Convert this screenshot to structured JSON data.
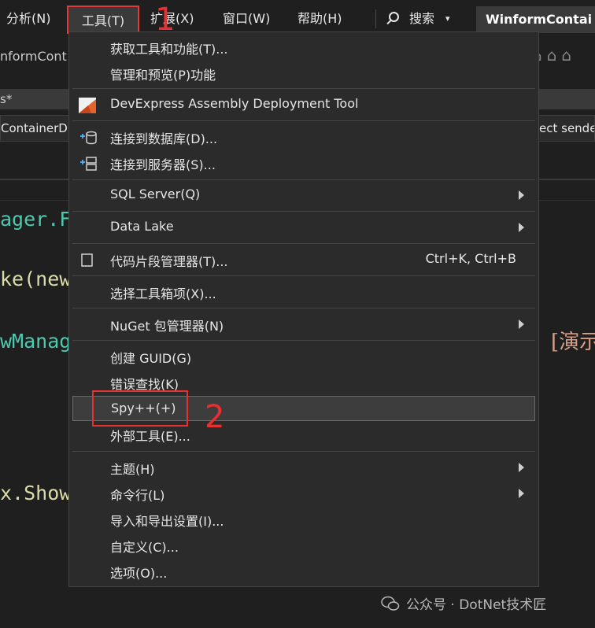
{
  "menubar": {
    "analyze": "分析(N)",
    "tools": "工具(T)",
    "extensions": "扩展(X)",
    "window": "窗口(W)",
    "help": "帮助(H)",
    "search": "搜索",
    "solution_title": "WinformContai"
  },
  "annotations": {
    "step1": "1",
    "step2": "2"
  },
  "background": {
    "title": "nformCont",
    "tab": "s*",
    "nav_left": "ContainerD",
    "nav_right": "ect sende",
    "code_1": "ager.Fi",
    "code_2": "ke(new",
    "code_3": "wManag",
    "code_4": "x.Show",
    "comment": "[演示"
  },
  "tools_menu": {
    "items": [
      {
        "label": "获取工具和功能(T)..."
      },
      {
        "label": "管理和预览(P)功能"
      },
      {
        "label": "DevExpress Assembly Deployment Tool",
        "icon": "devexpress-icon"
      },
      {
        "label": "连接到数据库(D)...",
        "icon": "connect-database-icon"
      },
      {
        "label": "连接到服务器(S)...",
        "icon": "connect-server-icon"
      },
      {
        "label": "SQL Server(Q)",
        "submenu": true
      },
      {
        "label": "Data Lake",
        "submenu": true
      },
      {
        "label": "代码片段管理器(T)...",
        "shortcut": "Ctrl+K, Ctrl+B",
        "icon": "code-snippet-icon"
      },
      {
        "label": "选择工具箱项(X)..."
      },
      {
        "label": "NuGet 包管理器(N)",
        "submenu": true
      },
      {
        "label": "创建 GUID(G)"
      },
      {
        "label": "错误查找(K)"
      },
      {
        "label": "Spy++(+)"
      },
      {
        "label": "外部工具(E)..."
      },
      {
        "label": "主题(H)",
        "submenu": true
      },
      {
        "label": "命令行(L)",
        "submenu": true
      },
      {
        "label": "导入和导出设置(I)..."
      },
      {
        "label": "自定义(C)..."
      },
      {
        "label": "选项(O)..."
      }
    ]
  },
  "footer": {
    "watermark": "公众号 · DotNet技术匠"
  },
  "colors": {
    "annotation_red": "#e8302f",
    "menu_bg": "#2b2b2b",
    "highlight": "#3d3d3d"
  }
}
